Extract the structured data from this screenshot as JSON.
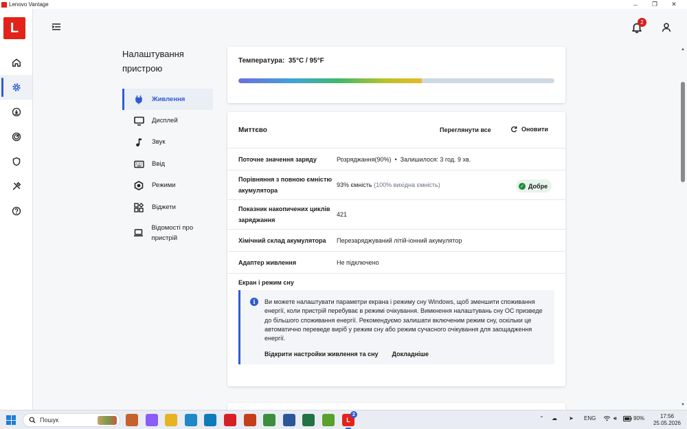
{
  "window": {
    "title": "Lenovo Vantage",
    "logo_letter": "L",
    "controls": {
      "minimize": "–",
      "maximize": "❐",
      "close": "✕"
    }
  },
  "rail": {
    "items": [
      {
        "name": "home",
        "icon": "home-icon"
      },
      {
        "name": "device",
        "icon": "gear-icon",
        "active": true
      },
      {
        "name": "updates",
        "icon": "download-icon"
      },
      {
        "name": "hardware",
        "icon": "radar-icon"
      },
      {
        "name": "security",
        "icon": "shield-icon"
      },
      {
        "name": "tools",
        "icon": "tools-icon"
      },
      {
        "name": "help",
        "icon": "help-icon"
      }
    ]
  },
  "header": {
    "notifications_count": "2"
  },
  "settings": {
    "title": "Налаштування пристрою",
    "nav": [
      {
        "label": "Живлення",
        "icon": "plug-icon",
        "active": true
      },
      {
        "label": "Дисплей",
        "icon": "monitor-icon"
      },
      {
        "label": "Звук",
        "icon": "music-note-icon"
      },
      {
        "label": "Ввід",
        "icon": "keyboard-icon"
      },
      {
        "label": "Режими",
        "icon": "hexagon-icon"
      },
      {
        "label": "Віджети",
        "icon": "widgets-icon"
      },
      {
        "label": "Відомості про пристрій",
        "icon": "laptop-icon"
      }
    ]
  },
  "temperature": {
    "label": "Температура:",
    "value": "35°C / 95°F",
    "level": 0.58
  },
  "battery": {
    "title": "Миттєво",
    "view_all": "Переглянути все",
    "refresh": "Оновити",
    "rows": [
      {
        "key": "Поточне значення заряду",
        "value": "Розряджання(90%)  •  Залишилося: 3 год. 9 хв."
      },
      {
        "key": "Порівняння з повною ємністю акумулятора",
        "value": "93% ємність",
        "value_muted": "(100% вихідна ємність)",
        "status": "Добре"
      },
      {
        "key": "Показник накопичених циклів заряджання",
        "value": "421"
      },
      {
        "key": "Хімічний склад акумулятора",
        "value": "Перезаряджуваний літій-іонний акумулятор"
      },
      {
        "key": "Адаптер живлення",
        "value": "Не підключено"
      }
    ],
    "sleep_title": "Екран і режим сну",
    "info_text": "Ви можете налаштувати параметри екрана і режиму сну Windows, щоб зменшити споживання енергії, коли пристрій перебуває в режимі очікування. Вимкнення налаштувань сну ОС призведе до більшого споживання енергії. Рекомендуємо залишати включеним режим сну, оскільки це автоматично переведе виріб у режим сну або режим сучасного очікування для заощадження енергії.",
    "link_open": "Відкрити настройки живлення та сну",
    "link_more": "Докладніше"
  },
  "taskbar": {
    "search_placeholder": "Пошук",
    "apps": [
      {
        "name": "copilot",
        "color": "#c5612c"
      },
      {
        "name": "colorful",
        "color": "#8b5cf6"
      },
      {
        "name": "file-explorer",
        "color": "#e6b422"
      },
      {
        "name": "desktop",
        "color": "#1e88c8"
      },
      {
        "name": "edge",
        "color": "#0f7bb8"
      },
      {
        "name": "opera",
        "color": "#d71f26"
      },
      {
        "name": "powerpoint",
        "color": "#c43e1c"
      },
      {
        "name": "chrome",
        "color": "#3b8d3f"
      },
      {
        "name": "word",
        "color": "#2b579a"
      },
      {
        "name": "excel",
        "color": "#217346"
      },
      {
        "name": "torrent",
        "color": "#5aa02c"
      },
      {
        "name": "vantage",
        "color": "#e2231a",
        "badge": "2",
        "running": true
      }
    ],
    "tray_lang": "ENG",
    "battery_percent": "90%",
    "time": "17:56",
    "date": "25.05.2026"
  }
}
